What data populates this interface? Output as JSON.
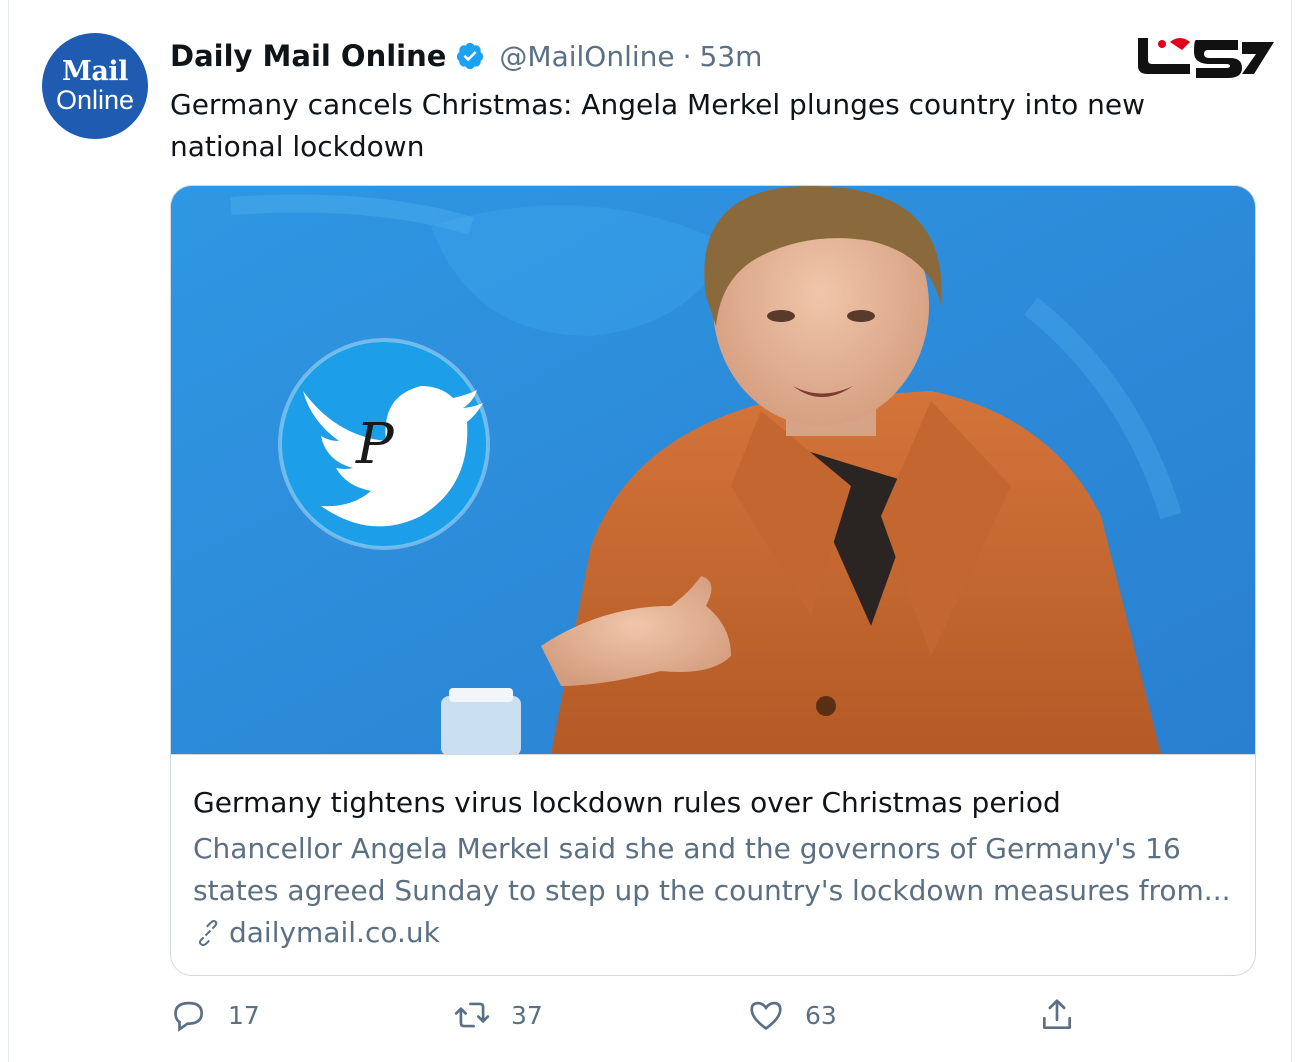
{
  "tweet": {
    "avatar": {
      "line1": "Mail",
      "line2": "Online"
    },
    "display_name": "Daily Mail Online",
    "handle": "@MailOnline",
    "separator": "·",
    "time": "53m",
    "text": "Germany cancels Christmas: Angela Merkel plunges country into new national lockdown"
  },
  "card": {
    "image_logo_letter": "P",
    "title": "Germany tightens virus lockdown rules over Christmas period",
    "description": "Chancellor Angela Merkel said she and the governors of Germany's 16 states agreed Sunday to step up the country's lockdown measures from...",
    "link": "dailymail.co.uk"
  },
  "actions": {
    "reply_count": "17",
    "retweet_count": "37",
    "like_count": "63"
  },
  "colors": {
    "brand_blue": "#1f5bb0",
    "twitter_blue": "#1da1f2",
    "watermark_red": "#e3001b",
    "muted_text": "#5b7083"
  }
}
